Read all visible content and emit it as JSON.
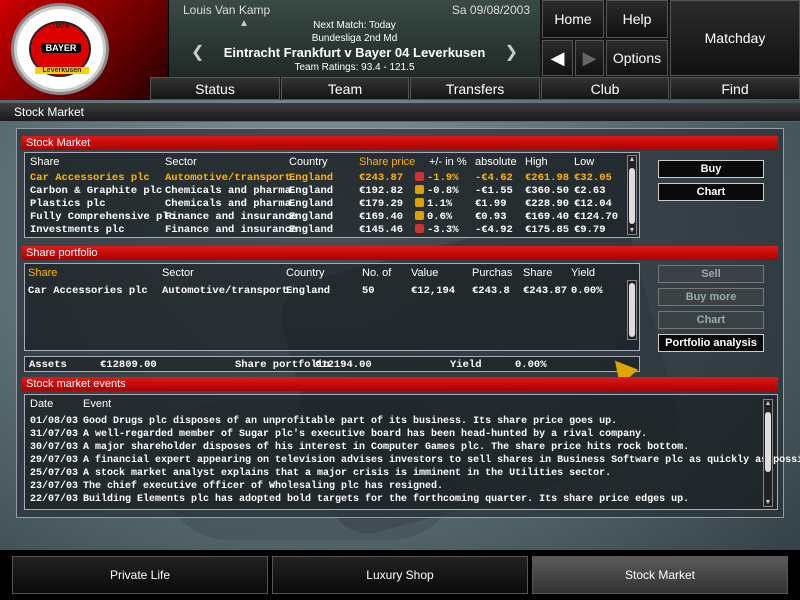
{
  "header": {
    "manager": "Louis Van Kamp",
    "date": "Sa 09/08/2003",
    "next_match": "Next Match: Today",
    "league": "Bundesliga 2nd Md",
    "fixture": "Eintracht Frankfurt v Bayer 04 Leverkusen",
    "ratings": "Team Ratings: 93.4 - 121.5",
    "crest": {
      "year": "1904",
      "name": "BAYER",
      "club": "Leverkusen"
    },
    "nav": {
      "home": "Home",
      "help": "Help",
      "options": "Options",
      "matchday": "Matchday"
    },
    "tabs": [
      "Status",
      "Team",
      "Transfers",
      "Club",
      "Find"
    ]
  },
  "page_title": "Stock Market",
  "stock_market": {
    "title": "Stock Market",
    "columns": {
      "share": "Share",
      "sector": "Sector",
      "country": "Country",
      "price": "Share price",
      "pct": "+/- in %",
      "absolute": "absolute",
      "high": "High",
      "low": "Low"
    },
    "rows": [
      {
        "share": "Car Accessories plc",
        "sector": "Automotive/transport.",
        "country": "England",
        "price": "€243.87",
        "dir": "down",
        "pct": "-1.9%",
        "absolute": "-€4.62",
        "high": "€261.98",
        "low": "€32.05",
        "selected": true
      },
      {
        "share": "Carbon & Graphite plc",
        "sector": "Chemicals and pharma.",
        "country": "England",
        "price": "€192.82",
        "dir": "up",
        "pct": "-0.8%",
        "absolute": "-€1.55",
        "high": "€360.50",
        "low": "€2.63",
        "selected": false
      },
      {
        "share": "Plastics plc",
        "sector": "Chemicals and pharma.",
        "country": "England",
        "price": "€179.29",
        "dir": "up",
        "pct": "1.1%",
        "absolute": "€1.99",
        "high": "€228.90",
        "low": "€12.04",
        "selected": false
      },
      {
        "share": "Fully Comprehensive plc",
        "sector": "Finance and insurance",
        "country": "England",
        "price": "€169.40",
        "dir": "up",
        "pct": "0.6%",
        "absolute": "€0.93",
        "high": "€169.40",
        "low": "€124.70",
        "selected": false
      },
      {
        "share": "Investments plc",
        "sector": "Finance and insurance",
        "country": "England",
        "price": "€145.46",
        "dir": "down",
        "pct": "-3.3%",
        "absolute": "-€4.92",
        "high": "€175.85",
        "low": "€9.79",
        "selected": false
      }
    ],
    "buttons": {
      "buy": "Buy",
      "chart": "Chart"
    }
  },
  "portfolio": {
    "title": "Share portfolio",
    "columns": {
      "share": "Share",
      "sector": "Sector",
      "country": "Country",
      "number": "No. of",
      "value": "Value",
      "purchase": "Purchas",
      "share_price": "Share",
      "yield": "Yield"
    },
    "rows": [
      {
        "share": "Car Accessories plc",
        "sector": "Automotive/transport.",
        "country": "England",
        "number": "50",
        "value": "€12,194",
        "purchase": "€243.8",
        "share_price": "€243.87",
        "yield": "0.00%"
      }
    ],
    "summary": {
      "assets_label": "Assets",
      "assets": "€12809.00",
      "portfolio_label": "Share portfolio",
      "portfolio": "€12194.00",
      "yield_label": "Yield",
      "yield": "0.00%"
    },
    "buttons": {
      "sell": "Sell",
      "buy_more": "Buy more",
      "chart": "Chart",
      "analysis": "Portfolio analysis"
    }
  },
  "events": {
    "title": "Stock market events",
    "columns": {
      "date": "Date",
      "event": "Event"
    },
    "rows": [
      {
        "date": "01/08/03",
        "event": "Good Drugs plc disposes of an unprofitable part of its business. Its share price goes up."
      },
      {
        "date": "31/07/03",
        "event": "A well-regarded member of Sugar plc's executive board has been head-hunted by a rival company."
      },
      {
        "date": "30/07/03",
        "event": "A major shareholder disposes of his interest in Computer Games plc. The share price hits rock bottom."
      },
      {
        "date": "29/07/03",
        "event": "A financial expert appearing on television advises investors to sell shares in Business Software plc as quickly as possible."
      },
      {
        "date": "25/07/03",
        "event": "A stock market analyst explains that a major crisis is imminent in the Utilities sector."
      },
      {
        "date": "23/07/03",
        "event": "The chief executive officer of Wholesaling plc has resigned."
      },
      {
        "date": "22/07/03",
        "event": "Building Elements plc has adopted bold targets for the forthcoming quarter. Its share price edges up."
      }
    ]
  },
  "bottom_tabs": [
    "Private Life",
    "Luxury Shop",
    "Stock Market"
  ]
}
